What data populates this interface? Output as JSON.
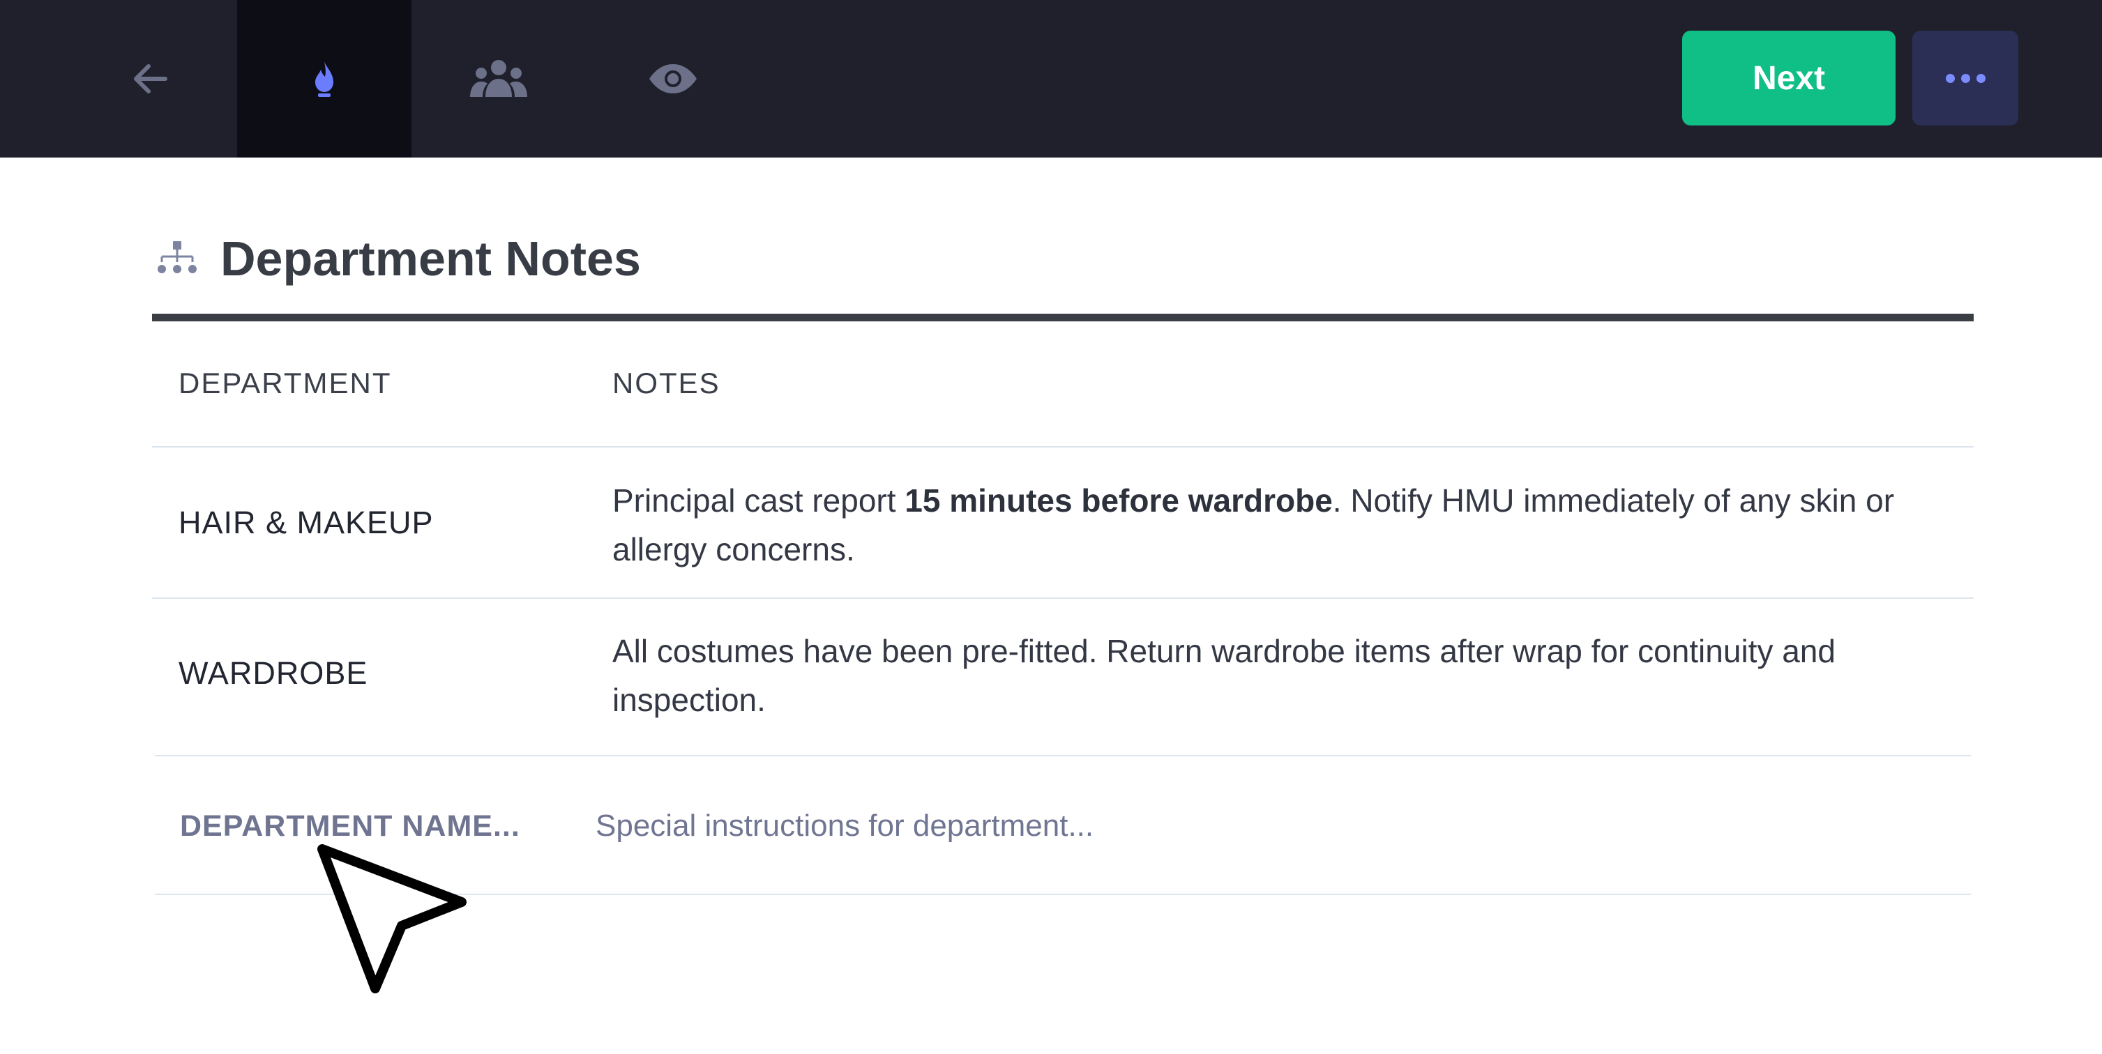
{
  "toolbar": {
    "tools": [
      {
        "icon": "back-arrow-icon",
        "selected": false
      },
      {
        "icon": "flame-icon",
        "selected": true
      },
      {
        "icon": "people-icon",
        "selected": false
      },
      {
        "icon": "eye-icon",
        "selected": false
      }
    ],
    "next_label": "Next",
    "more_icon": "more-dots-icon"
  },
  "section": {
    "icon": "hierarchy-icon",
    "title": "Department Notes"
  },
  "table": {
    "headers": {
      "department": "DEPARTMENT",
      "notes": "NOTES"
    },
    "rows": [
      {
        "department": "HAIR & MAKEUP",
        "note_before": "Principal cast report ",
        "note_bold": "15 minutes before wardrobe",
        "note_after": ". Notify HMU immediately of any skin or allergy concerns."
      },
      {
        "department": "WARDROBE",
        "note_before": "All costumes have been pre-fitted. Return wardrobe items after wrap for continuity and inspection.",
        "note_bold": "",
        "note_after": ""
      }
    ],
    "new_row": {
      "department_placeholder": "DEPARTMENT NAME...",
      "department_value": "",
      "notes_placeholder": "Special instructions for department...",
      "notes_value": ""
    }
  },
  "colors": {
    "toolbar_bg": "#1f202c",
    "selected_tool_bg": "#0d0d15",
    "accent_blue": "#6b7cff",
    "next_green": "#0fbf86",
    "more_button_bg": "#2b2f55",
    "icon_muted": "#6c7089"
  }
}
